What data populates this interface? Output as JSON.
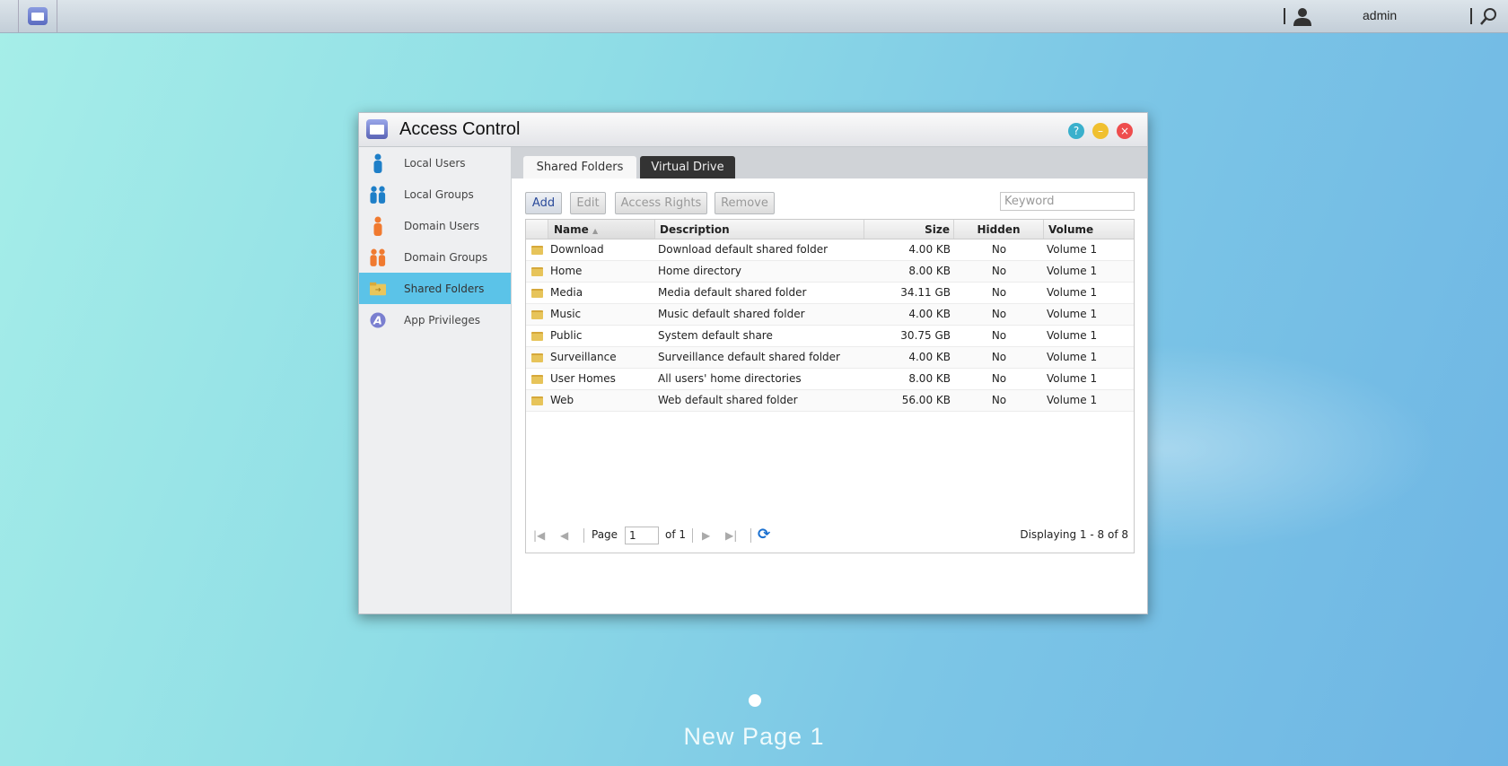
{
  "topbar": {
    "user": "admin"
  },
  "window": {
    "title": "Access Control",
    "help": "?",
    "minimize": "–",
    "close": "×"
  },
  "sidebar": {
    "items": [
      {
        "label": "Local Users"
      },
      {
        "label": "Local Groups"
      },
      {
        "label": "Domain Users"
      },
      {
        "label": "Domain Groups"
      },
      {
        "label": "Shared Folders"
      },
      {
        "label": "App Privileges"
      }
    ]
  },
  "tabs": [
    "Shared Folders",
    "Virtual Drive"
  ],
  "toolbar": {
    "add": "Add",
    "edit": "Edit",
    "access_rights": "Access Rights",
    "remove": "Remove",
    "keyword_placeholder": "Keyword"
  },
  "grid": {
    "columns": [
      "Name",
      "Description",
      "Size",
      "Hidden",
      "Volume"
    ],
    "sort_indicator": "▲",
    "rows": [
      [
        "Download",
        "Download default shared folder",
        "4.00 KB",
        "No",
        "Volume 1"
      ],
      [
        "Home",
        "Home directory",
        "8.00 KB",
        "No",
        "Volume 1"
      ],
      [
        "Media",
        "Media default shared folder",
        "34.11 GB",
        "No",
        "Volume 1"
      ],
      [
        "Music",
        "Music default shared folder",
        "4.00 KB",
        "No",
        "Volume 1"
      ],
      [
        "Public",
        "System default share",
        "30.75 GB",
        "No",
        "Volume 1"
      ],
      [
        "Surveillance",
        "Surveillance default shared folder",
        "4.00 KB",
        "No",
        "Volume 1"
      ],
      [
        "User Homes",
        "All users' home directories",
        "8.00 KB",
        "No",
        "Volume 1"
      ],
      [
        "Web",
        "Web default shared folder",
        "56.00 KB",
        "No",
        "Volume 1"
      ]
    ]
  },
  "pager": {
    "page_label": "Page",
    "page": "1",
    "of": "of 1",
    "displaying": "Displaying 1 - 8 of 8"
  },
  "desktop": {
    "page_name": "New Page 1"
  }
}
